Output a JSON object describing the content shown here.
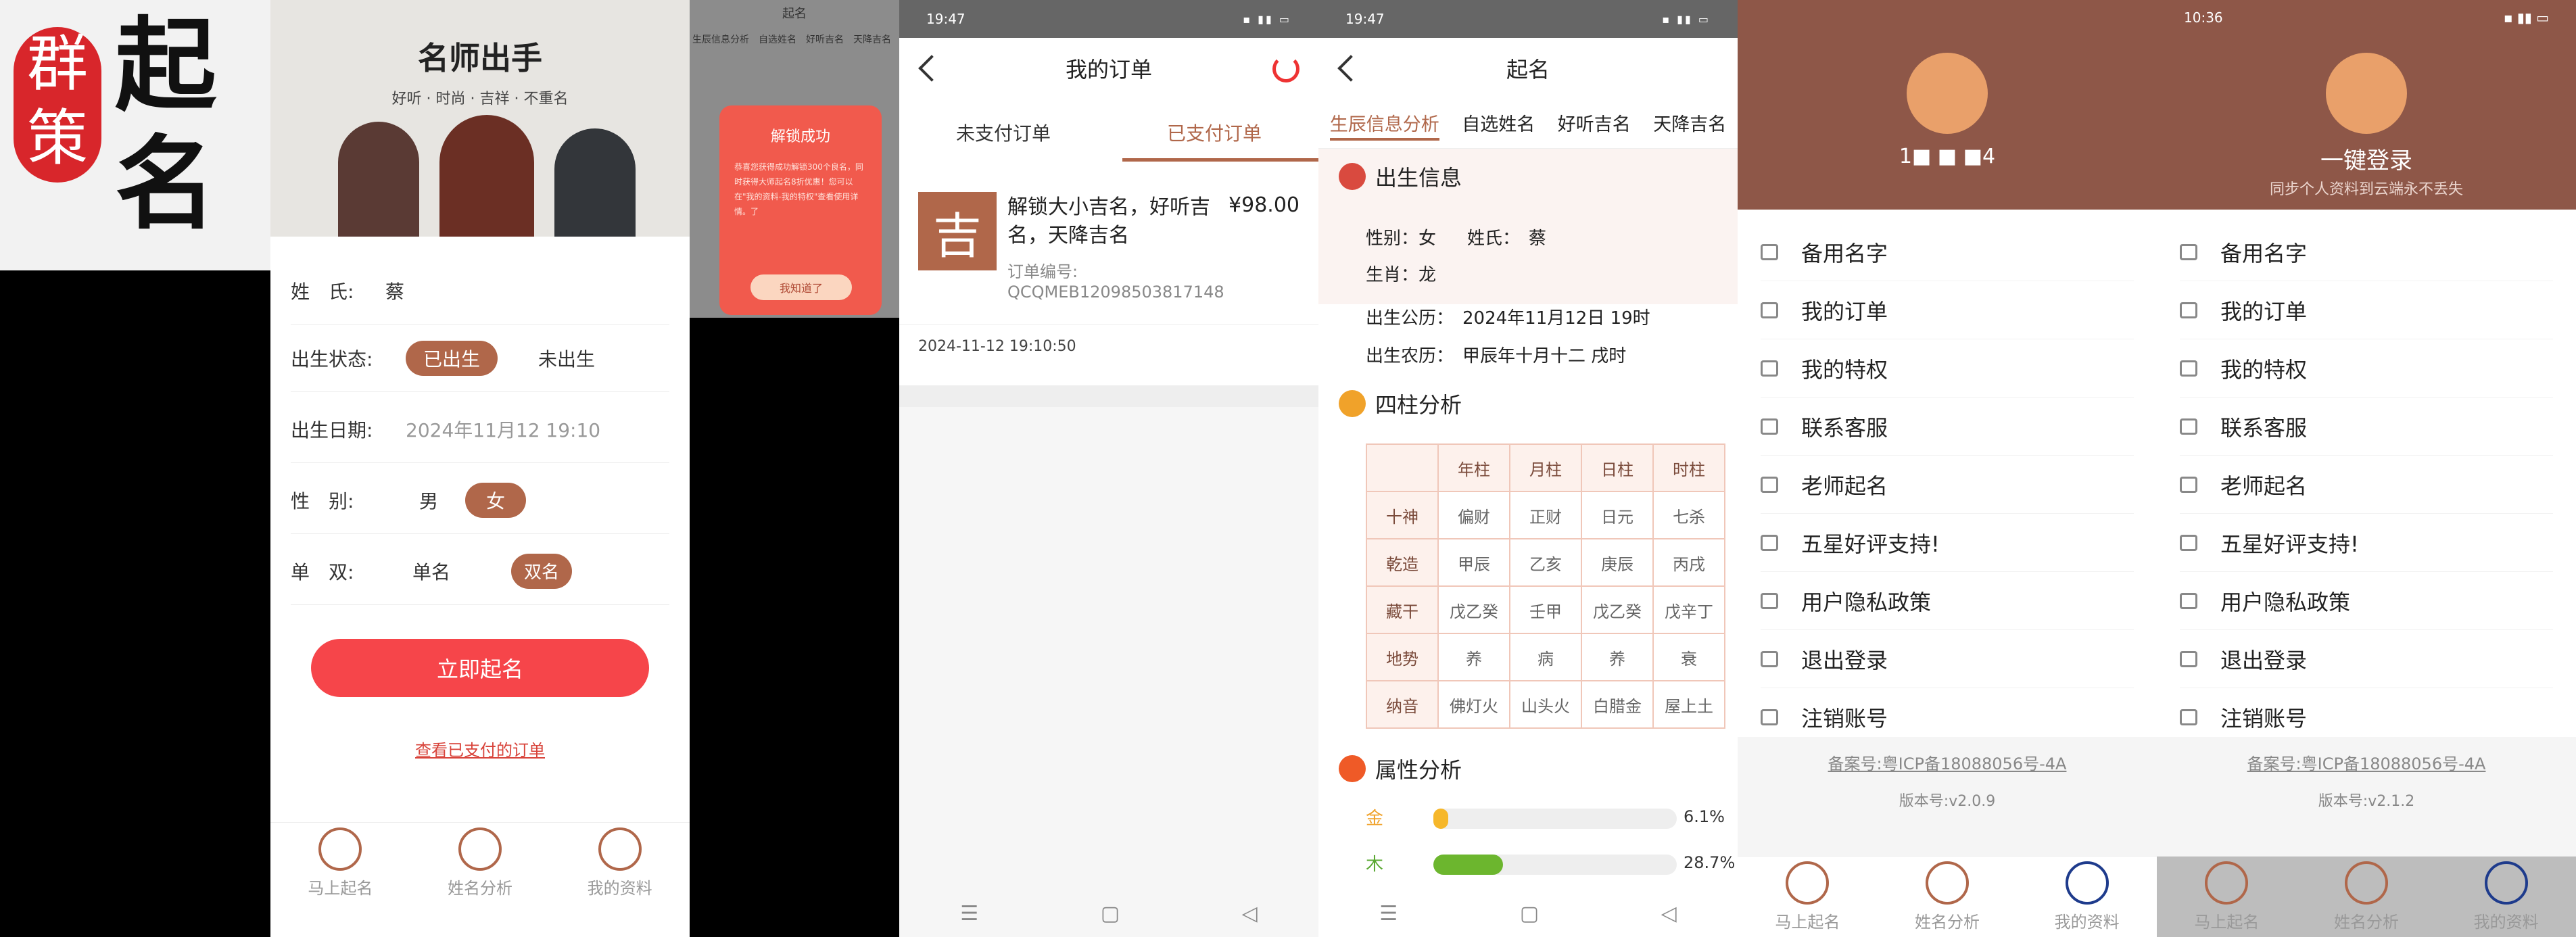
{
  "logo": {
    "chars": [
      "群",
      "策"
    ],
    "title": [
      "起",
      "名"
    ]
  },
  "p1": {
    "banner_title": "名师出手",
    "banner_tagline": "好听 · 时尚 · 吉祥 · 不重名",
    "surname_label": "姓　氏:",
    "surname_value": "蔡",
    "birth_label": "出生状态:",
    "born": "已出生",
    "unborn": "未出生",
    "date_label": "出生日期:",
    "date_value": "2024年11月12 19:10",
    "gender_label": "性　别:",
    "male": "男",
    "female": "女",
    "count_label": "单　双:",
    "single": "单名",
    "double": "双名",
    "submit": "立即起名",
    "paid_link": "查看已支付的订单"
  },
  "tabs": [
    "马上起名",
    "姓名分析",
    "我的资料"
  ],
  "p2": {
    "title": "起名",
    "tabs": [
      "生辰信息分析",
      "自选姓名",
      "好听吉名",
      "天降吉名"
    ],
    "dialog_title": "解锁成功",
    "dialog_text": "恭喜您获得成功解锁300个良名，同时获得大师起名8折优惠！您可以在\"我的资料-我的特权\"查看使用详情。了",
    "dialog_btn": "我知道了"
  },
  "p3": {
    "time": "19:47",
    "title": "我的订单",
    "tab_unpaid": "未支付订单",
    "tab_paid": "已支付订单",
    "order_char": "吉",
    "order_name": "解锁大小吉名，好听吉名，天降吉名",
    "order_price": "¥98.00",
    "order_no_label": "订单编号:",
    "order_no": "QCQMEB12098503817148",
    "order_time": "2024-11-12 19:10:50"
  },
  "p4": {
    "time": "19:47",
    "title": "起名",
    "tabs": [
      "生辰信息分析",
      "自选姓名",
      "好听吉名",
      "天降吉名"
    ],
    "birth_title": "出生信息",
    "gender": "性别：女",
    "surname": "姓氏：　蔡",
    "zodiac": "生肖：龙",
    "solar": "出生公历：　2024年11月12日 19时",
    "lunar": "出生农历：　甲辰年十月十二 戌时",
    "pillar_title": "四柱分析",
    "cols": [
      "年柱",
      "月柱",
      "日柱",
      "时柱"
    ],
    "rows": [
      {
        "h": "十神",
        "v": [
          "偏财",
          "正财",
          "日元",
          "七杀"
        ]
      },
      {
        "h": "乾造",
        "v": [
          "甲辰",
          "乙亥",
          "庚辰",
          "丙戌"
        ]
      },
      {
        "h": "藏干",
        "v": [
          "戊乙癸",
          "壬甲",
          "戊乙癸",
          "戊辛丁"
        ]
      },
      {
        "h": "地势",
        "v": [
          "养",
          "病",
          "养",
          "衰"
        ]
      },
      {
        "h": "纳音",
        "v": [
          "佛灯火",
          "山头火",
          "白腊金",
          "屋上土"
        ]
      }
    ],
    "attr_title": "属性分析",
    "metal": "金",
    "metal_pct": "6.1%",
    "metal_val": 6.1,
    "wood": "木",
    "wood_pct": "28.7%",
    "wood_val": 28.7
  },
  "menu": [
    "备用名字",
    "我的订单",
    "我的特权",
    "联系客服",
    "老师起名",
    "五星好评支持!",
    "用户隐私政策",
    "退出登录",
    "注销账号"
  ],
  "p5": {
    "user": "1■ ■ ■4",
    "icp": "备案号:粤ICP备18088056号-4A",
    "version": "版本号:v2.0.9"
  },
  "p6": {
    "time": "10:36",
    "login": "一键登录",
    "login_sub": "同步个人资料到云端永不丢失",
    "icp": "备案号:粤ICP备18088056号-4A",
    "version": "版本号:v2.1.2"
  },
  "colors": {
    "accent": "#b0674a",
    "red": "#f6454a",
    "header": "#8e5748"
  }
}
